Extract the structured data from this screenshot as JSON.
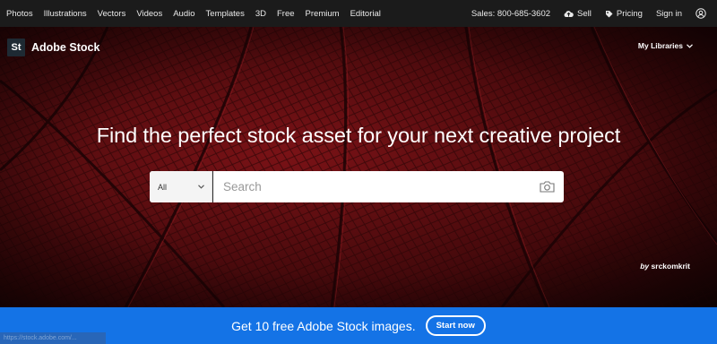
{
  "nav": {
    "left": [
      "Photos",
      "Illustrations",
      "Vectors",
      "Videos",
      "Audio",
      "Templates",
      "3D",
      "Free",
      "Premium",
      "Editorial"
    ],
    "sales": "Sales: 800-685-3602",
    "sell": "Sell",
    "pricing": "Pricing",
    "signin": "Sign in",
    "icons": {
      "sell": "cloud-upload-icon",
      "pricing": "tag-icon",
      "account": "user-circle-icon"
    }
  },
  "brand": {
    "logo": "St",
    "name": "Adobe Stock"
  },
  "my_libraries": "My Libraries",
  "hero": {
    "headline": "Find the perfect stock asset for your next creative project",
    "credit_prefix": "by",
    "credit_name": "srckomkrit"
  },
  "search": {
    "scope": "All",
    "placeholder": "Search",
    "camera_icon": "camera-icon"
  },
  "promo": {
    "text": "Get 10 free Adobe Stock images.",
    "button": "Start now"
  },
  "status": "https://stock.adobe.com/...",
  "colors": {
    "topbar": "#1b1b1b",
    "hero_red": "#5a0d10",
    "promo_blue": "#1473e6",
    "white": "#ffffff"
  }
}
